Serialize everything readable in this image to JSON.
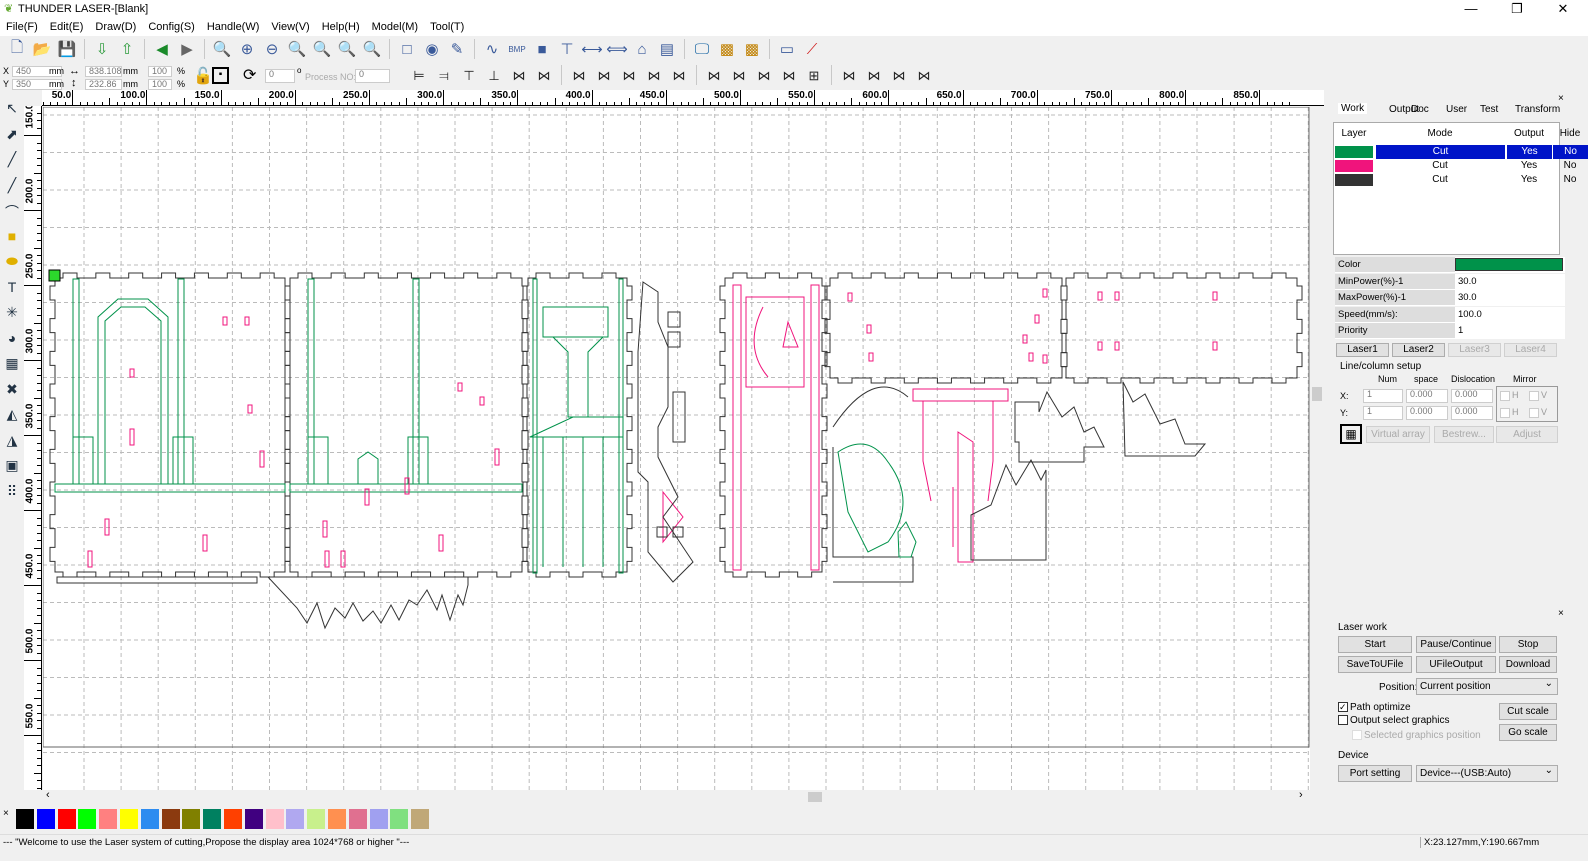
{
  "window": {
    "title": "THUNDER LASER-[Blank]",
    "minimize": "—",
    "maximize": "❐",
    "close": "✕"
  },
  "menu": [
    "File(F)",
    "Edit(E)",
    "Draw(D)",
    "Config(S)",
    "Handle(W)",
    "View(V)",
    "Help(H)",
    "Model(M)",
    "Tool(T)"
  ],
  "toolbar_icons": [
    "new-file-icon",
    "open-folder-icon",
    "save-icon",
    "|",
    "import-icon",
    "export-icon",
    "|",
    "undo-icon",
    "redo-icon",
    "|",
    "zoom-in-icon",
    "zoom-plus-icon",
    "zoom-minus-icon",
    "zoom-page-icon",
    "zoom-fit-icon",
    "zoom-all-icon",
    "zoom-search-icon",
    "|",
    "rectangle-icon",
    "node-icon",
    "pen-icon",
    "|",
    "curve-icon",
    "bmp-icon",
    "fill-icon",
    "tree-icon",
    "space-h-icon",
    "space-v-icon",
    "machine-icon",
    "document-icon",
    "|",
    "monitor-icon",
    "array-icon",
    "array2-icon",
    "|",
    "camera-icon",
    "laser-pointer-icon"
  ],
  "position": {
    "x_label": "X",
    "x": "450",
    "y_label": "Y",
    "y": "350",
    "unit": "mm",
    "width": "838.108",
    "height": "232.86",
    "scale_x": "100",
    "scale_y": "100",
    "percent": "%",
    "rotate": "0",
    "degree": "o",
    "process_label": "Process NO:",
    "process_no": "0"
  },
  "ruler_h": [
    "50.0",
    "100.0",
    "150.0",
    "200.0",
    "250.0",
    "300.0",
    "350.0",
    "400.0",
    "450.0",
    "500.0",
    "550.0",
    "600.0",
    "650.0",
    "700.0",
    "750.0",
    "800.0",
    "850.0"
  ],
  "ruler_v": [
    "150.0",
    "200.0",
    "250.0",
    "300.0",
    "350.0",
    "400.0",
    "450.0",
    "500.0",
    "550.0"
  ],
  "panel": {
    "tabs": [
      "Work",
      "Output",
      "Doc",
      "User",
      "Test",
      "Transform"
    ],
    "layer_headers": [
      "Layer",
      "Mode",
      "Output",
      "Hide"
    ],
    "layers": [
      {
        "color": "#00924a",
        "mode": "Cut",
        "output": "Yes",
        "hide": "No"
      },
      {
        "color": "#f0147c",
        "mode": "Cut",
        "output": "Yes",
        "hide": "No"
      },
      {
        "color": "#333333",
        "mode": "Cut",
        "output": "Yes",
        "hide": "No"
      }
    ],
    "props": [
      {
        "label": "Color",
        "value": ""
      },
      {
        "label": "MinPower(%)-1",
        "value": "30.0"
      },
      {
        "label": "MaxPower(%)-1",
        "value": "30.0"
      },
      {
        "label": "Speed(mm/s):",
        "value": "100.0"
      },
      {
        "label": "Priority",
        "value": "1"
      }
    ],
    "lasers": [
      "Laser1",
      "Laser2",
      "Laser3",
      "Laser4"
    ],
    "linecol": {
      "title": "Line/column setup",
      "num": "Num",
      "space": "space",
      "dislocation": "Dislocation",
      "mirror": "Mirror",
      "x": "X:",
      "y": "Y:",
      "x_num": "1",
      "x_space": "0.000",
      "x_disl": "0.000",
      "y_num": "1",
      "y_space": "0.000",
      "y_disl": "0.000",
      "h": "H",
      "v": "V"
    },
    "virtual_array": "Virtual array",
    "bestrew": "Bestrew...",
    "adjust": "Adjust"
  },
  "laserwork": {
    "title": "Laser work",
    "start": "Start",
    "pause": "Pause/Continue",
    "stop": "Stop",
    "save": "SaveToUFile",
    "ufile": "UFileOutput",
    "download": "Download",
    "position_label": "Position:",
    "position": "Current position",
    "path_optimize": "Path optimize",
    "output_select": "Output select graphics",
    "selected_pos": "Selected graphics position",
    "cut_scale": "Cut scale",
    "go_scale": "Go scale",
    "device_title": "Device",
    "port_setting": "Port setting",
    "device": "Device---(USB:Auto)"
  },
  "palette": [
    "#000000",
    "#0000ff",
    "#ff0000",
    "#00ff00",
    "#ff8080",
    "#ffff00",
    "#2d8cf0",
    "#8b3a0f",
    "#808000",
    "#008060",
    "#ff4000",
    "#400080",
    "#ffc0cb",
    "#b0a8f0",
    "#c8f08c",
    "#ff9050",
    "#e07090",
    "#a0a0f0",
    "#80e080",
    "#c0a878"
  ],
  "status": {
    "message": "--- \"Welcome to use the Laser system of cutting,Propose the display area 1024*768 or higher \"---",
    "coords": "X:23.127mm,Y:190.667mm"
  }
}
